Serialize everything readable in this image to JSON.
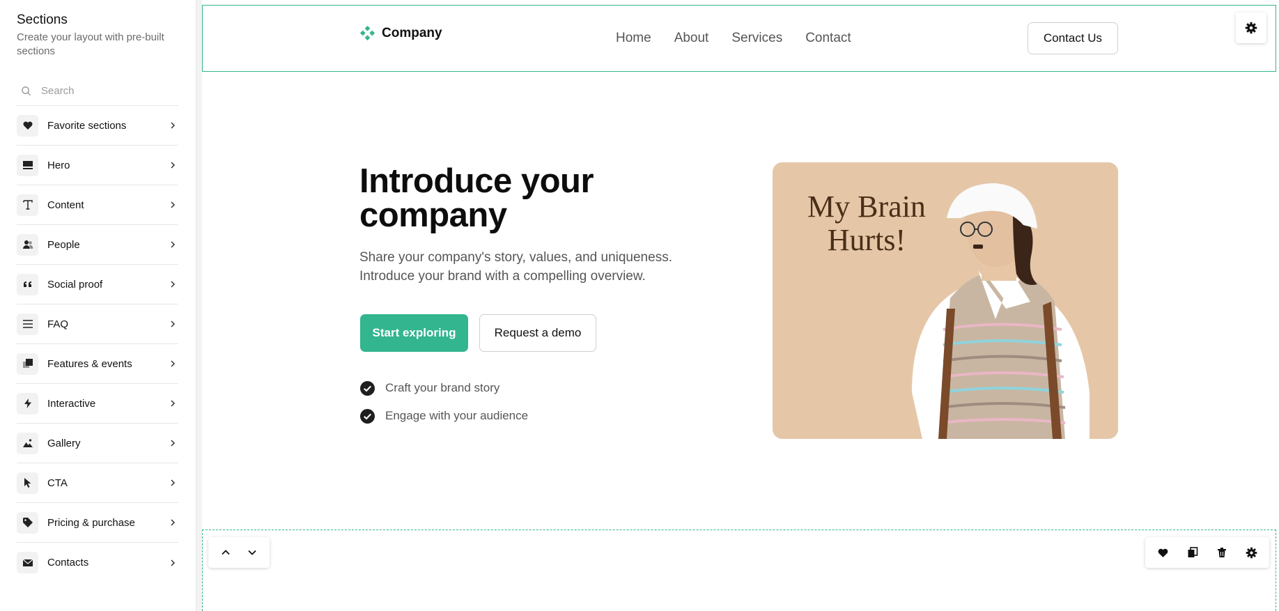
{
  "sidebar": {
    "title": "Sections",
    "subtitle": "Create your layout with pre-built sections",
    "search_placeholder": "Search",
    "items": [
      {
        "label": "Favorite sections",
        "icon": "heart-icon"
      },
      {
        "label": "Hero",
        "icon": "hero-layout-icon"
      },
      {
        "label": "Content",
        "icon": "text-icon"
      },
      {
        "label": "People",
        "icon": "people-icon"
      },
      {
        "label": "Social proof",
        "icon": "quote-icon"
      },
      {
        "label": "FAQ",
        "icon": "list-icon"
      },
      {
        "label": "Features & events",
        "icon": "features-icon"
      },
      {
        "label": "Interactive",
        "icon": "lightning-icon"
      },
      {
        "label": "Gallery",
        "icon": "image-icon"
      },
      {
        "label": "CTA",
        "icon": "cursor-icon"
      },
      {
        "label": "Pricing & purchase",
        "icon": "tag-icon"
      },
      {
        "label": "Contacts",
        "icon": "envelope-icon"
      }
    ]
  },
  "navbar": {
    "brand": "Company",
    "links": [
      "Home",
      "About",
      "Services",
      "Contact"
    ],
    "cta": "Contact Us"
  },
  "hero": {
    "title": "Introduce your company",
    "text": "Share your company's story, values, and uniqueness. Introduce your brand with a compelling overview.",
    "primary_button": "Start exploring",
    "secondary_button": "Request a demo",
    "checks": [
      "Craft your brand story",
      "Engage with your audience"
    ],
    "image_caption": "My Brain Hurts!"
  },
  "colors": {
    "accent": "#33b58f",
    "image_bg": "#e5c7a8"
  }
}
